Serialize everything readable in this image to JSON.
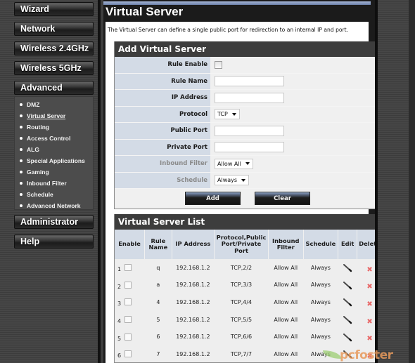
{
  "sidebar": {
    "buttons": [
      {
        "label": "Wizard"
      },
      {
        "label": "Network"
      },
      {
        "label": "Wireless 2.4GHz"
      },
      {
        "label": "Wireless 5GHz"
      },
      {
        "label": "Advanced"
      },
      {
        "label": "Administrator"
      },
      {
        "label": "Help"
      }
    ],
    "advanced_items": [
      {
        "label": "DMZ",
        "active": false
      },
      {
        "label": "Virtual Server",
        "active": true
      },
      {
        "label": "Routing",
        "active": false
      },
      {
        "label": "Access Control",
        "active": false
      },
      {
        "label": "ALG",
        "active": false
      },
      {
        "label": "Special Applications",
        "active": false
      },
      {
        "label": "Gaming",
        "active": false
      },
      {
        "label": "Inbound Filter",
        "active": false
      },
      {
        "label": "Schedule",
        "active": false
      },
      {
        "label": "Advanced Network",
        "active": false
      }
    ]
  },
  "page": {
    "title": "Virtual Server",
    "description": "The Virtual Server can define a single public port for redirection to an internal IP and port."
  },
  "add_panel": {
    "title": "Add Virtual Server",
    "fields": {
      "rule_enable": {
        "label": "Rule Enable",
        "checked": false
      },
      "rule_name": {
        "label": "Rule Name",
        "value": ""
      },
      "ip_address": {
        "label": "IP Address",
        "value": ""
      },
      "protocol": {
        "label": "Protocol",
        "selected": "TCP"
      },
      "public_port": {
        "label": "Public Port",
        "value": ""
      },
      "private_port": {
        "label": "Private Port",
        "value": ""
      },
      "inbound_filter": {
        "label": "Inbound Filter",
        "selected": "Allow All"
      },
      "schedule": {
        "label": "Schedule",
        "selected": "Always"
      }
    },
    "add_label": "Add",
    "clear_label": "Clear"
  },
  "list_panel": {
    "title": "Virtual Server List",
    "columns": [
      "Enable",
      "Rule Name",
      "IP Address",
      "Protocol,Public Port/Private Port",
      "Inbound Filter",
      "Schedule",
      "Edit",
      "Delete"
    ],
    "rows": [
      {
        "index": "1",
        "enabled": false,
        "rule_name": "q",
        "ip": "192.168.1.2",
        "protocol": "TCP,2/2",
        "filter": "Allow All",
        "schedule": "Always"
      },
      {
        "index": "2",
        "enabled": false,
        "rule_name": "a",
        "ip": "192.168.1.2",
        "protocol": "TCP,3/3",
        "filter": "Allow All",
        "schedule": "Always"
      },
      {
        "index": "3",
        "enabled": false,
        "rule_name": "4",
        "ip": "192.168.1.2",
        "protocol": "TCP,4/4",
        "filter": "Allow All",
        "schedule": "Always"
      },
      {
        "index": "4",
        "enabled": false,
        "rule_name": "5",
        "ip": "192.168.1.2",
        "protocol": "TCP,5/5",
        "filter": "Allow All",
        "schedule": "Always"
      },
      {
        "index": "5",
        "enabled": false,
        "rule_name": "6",
        "ip": "192.168.1.2",
        "protocol": "TCP,6/6",
        "filter": "Allow All",
        "schedule": "Always"
      },
      {
        "index": "6",
        "enabled": false,
        "rule_name": "7",
        "ip": "192.168.1.2",
        "protocol": "TCP,7/7",
        "filter": "Allow All",
        "schedule": "Always"
      }
    ]
  },
  "watermark": {
    "text": "pcfoster"
  }
}
